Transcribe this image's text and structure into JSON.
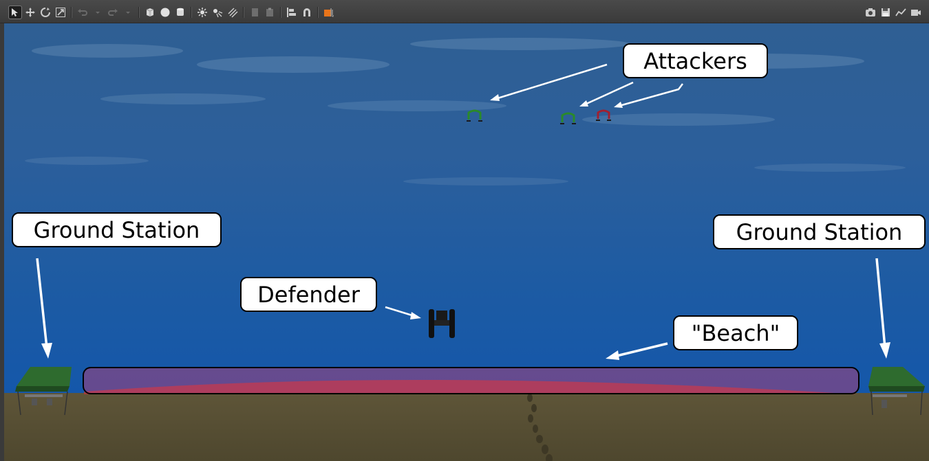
{
  "toolbar": {
    "left_tools": [
      "select-mode-icon",
      "translate-mode-icon",
      "rotate-mode-icon",
      "scale-mode-icon",
      "undo-icon",
      "undo-history-icon",
      "redo-icon",
      "redo-history-icon",
      "box-shape-icon",
      "sphere-shape-icon",
      "cylinder-shape-icon",
      "point-light-icon",
      "spot-light-icon",
      "directional-light-icon",
      "copy-icon",
      "paste-icon",
      "align-icon",
      "magnet-snap-icon",
      "view-angle-icon"
    ],
    "right_tools": [
      "screenshot-icon",
      "log-icon",
      "plot-icon",
      "record-video-icon"
    ]
  },
  "labels": {
    "attackers": "Attackers",
    "ground_station_left": "Ground Station",
    "ground_station_right": "Ground Station",
    "defender": "Defender",
    "beach": "\"Beach\""
  },
  "colors": {
    "water": "#1c5ba5",
    "sand": "#5a5236",
    "beach_zone": "#c83c6e",
    "tent_canopy": "#2e6b2e",
    "attacker_green": "#2a8a2a",
    "attacker_red": "#a02030"
  }
}
